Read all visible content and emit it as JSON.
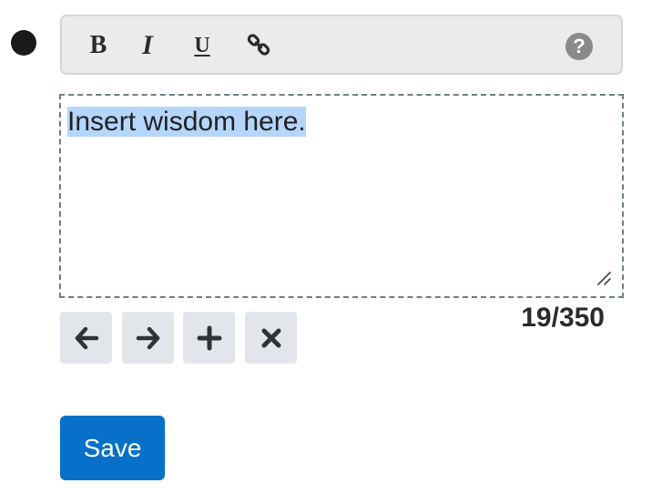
{
  "toolbar": {
    "bold_label": "B",
    "italic_label": "I",
    "underline_label": "U",
    "link_icon": "link-icon",
    "help_label": "?"
  },
  "editor": {
    "value": "Insert wisdom here.",
    "selected": true
  },
  "counter": {
    "text": "19/350"
  },
  "controls": {
    "icons": [
      "arrow-left-icon",
      "arrow-right-icon",
      "plus-icon",
      "close-icon"
    ]
  },
  "save_label": "Save",
  "colors": {
    "primary": "#0770c8",
    "selection": "#b5d5fb",
    "toolbar_bg": "#ebebeb",
    "control_bg": "#e2e6ea",
    "dashed_border": "#6a8190"
  }
}
